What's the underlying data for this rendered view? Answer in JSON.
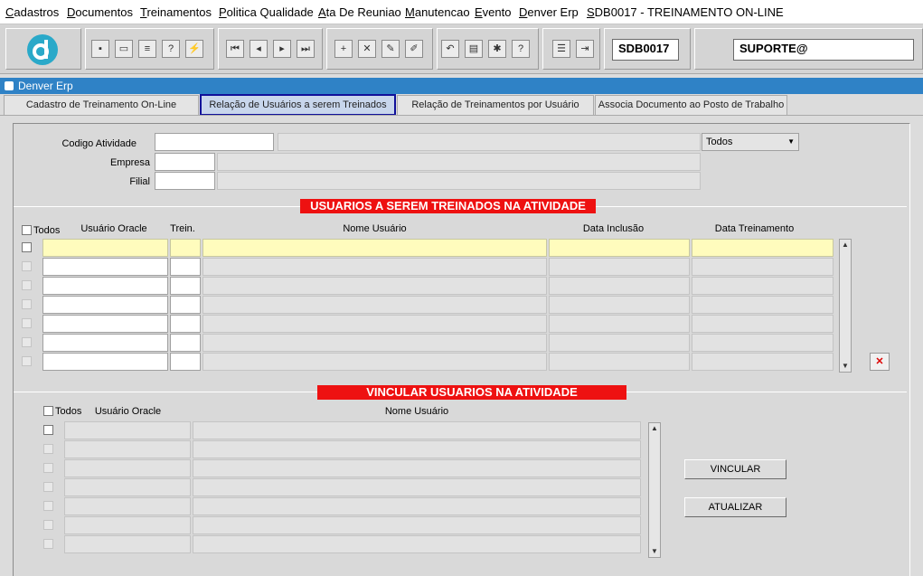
{
  "menu": [
    "Cadastros",
    "Documentos",
    "Treinamentos",
    "Politica Qualidade",
    "Ata De Reuniao",
    "Manutencao",
    "Evento",
    "Denver Erp",
    "SDB0017 - TREINAMENTO ON-LINE"
  ],
  "toolbar": {
    "form_code": "SDB0017",
    "user": "SUPORTE@"
  },
  "window": {
    "title": "Denver Erp"
  },
  "tabs": [
    "Cadastro de Treinamento On-Line",
    "Relação de Usuários a serem Treinados",
    "Relação de Treinamentos por Usuário",
    "Associa Documento ao Posto de Trabalho"
  ],
  "form": {
    "codigo_label": "Codigo Atividade",
    "empresa_label": "Empresa",
    "filial_label": "Filial",
    "status_select": "Todos"
  },
  "section1": {
    "title": "USUARIOS A SEREM TREINADOS NA ATIVIDADE",
    "todos_label": "Todos",
    "columns": [
      "Usuário Oracle",
      "Trein.",
      "Nome Usuário",
      "Data Inclusão",
      "Data Treinamento"
    ]
  },
  "section2": {
    "title": "VINCULAR USUARIOS NA ATIVIDADE",
    "todos_label": "Todos",
    "columns": [
      "Usuário Oracle",
      "Nome Usuário"
    ],
    "vincular_button": "VINCULAR",
    "atualizar_button": "ATUALIZAR"
  },
  "icons": {
    "logo": "denver-logo-icon",
    "table_action": "delete-record-icon"
  },
  "colors": {
    "title_bar": "#2f82c6",
    "banner": "#ee1111",
    "current_row": "#fffcbd",
    "active_tab_border": "#10109a"
  }
}
